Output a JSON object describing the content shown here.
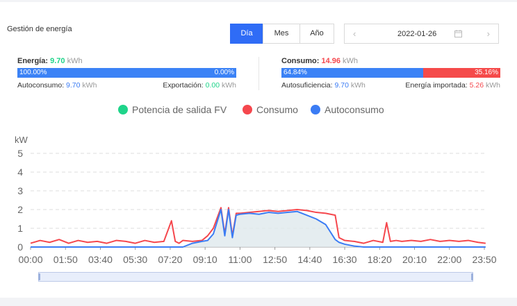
{
  "header": {
    "title": "Gestión de energía",
    "tabs": [
      {
        "label": "Día",
        "active": true
      },
      {
        "label": "Mes",
        "active": false
      },
      {
        "label": "Año",
        "active": false
      }
    ],
    "date": "2022-01-26",
    "prev_icon": "chevron-left-icon",
    "next_icon": "chevron-right-icon",
    "calendar_icon": "calendar-icon"
  },
  "energy": {
    "label": "Energía:",
    "value": "9.70",
    "unit": "kWh",
    "bar_left_pct": "100.00%",
    "bar_right_pct": "0.00%",
    "bar_left_fraction": 1.0,
    "self_consumption_label": "Autoconsumo:",
    "self_consumption_value": "9.70",
    "export_label": "Exportación:",
    "export_value": "0.00"
  },
  "consumption": {
    "label": "Consumo:",
    "value": "14.96",
    "unit": "kWh",
    "bar_left_pct": "64.84%",
    "bar_right_pct": "35.16%",
    "bar_left_fraction": 0.6484,
    "self_sufficiency_label": "Autosuficiencia:",
    "self_sufficiency_value": "9.70",
    "imported_label": "Energía importada:",
    "imported_value": "5.26"
  },
  "colors": {
    "accent": "#2f6cf6",
    "pv": "#1fd48a",
    "consumption": "#f5474d",
    "self_consumption": "#3b7cf4",
    "bar_blue": "#3b82f6",
    "bar_red": "#f54a4a"
  },
  "chart_data": {
    "type": "line",
    "ylabel": "kW",
    "ylim": [
      0,
      5
    ],
    "yticks": [
      "0",
      "1",
      "2",
      "3",
      "4",
      "5"
    ],
    "xticks": [
      "00:00",
      "01:50",
      "03:40",
      "05:30",
      "07:20",
      "09:10",
      "11:00",
      "12:50",
      "14:40",
      "16:30",
      "18:20",
      "20:10",
      "22:00",
      "23:50"
    ],
    "legend": [
      {
        "name": "Potencia de salida FV",
        "color": "#1fd48a"
      },
      {
        "name": "Consumo",
        "color": "#f5474d"
      },
      {
        "name": "Autoconsumo",
        "color": "#3b7cf4"
      }
    ],
    "x_hours": [
      0,
      0.5,
      1,
      1.5,
      2,
      2.5,
      3,
      3.5,
      4,
      4.5,
      5,
      5.5,
      6,
      6.5,
      7,
      7.4,
      7.6,
      7.8,
      8,
      8.5,
      9,
      9.3,
      9.6,
      10,
      10.2,
      10.4,
      10.6,
      10.8,
      11,
      11.5,
      12,
      12.5,
      13,
      13.5,
      14,
      14.5,
      15,
      15.5,
      16,
      16.2,
      16.5,
      17,
      17.5,
      18,
      18.5,
      18.7,
      18.9,
      19.2,
      19.5,
      20,
      20.5,
      21,
      21.5,
      22,
      22.5,
      23,
      23.5,
      23.9
    ],
    "series": [
      {
        "name": "Consumo",
        "values": [
          0.2,
          0.35,
          0.25,
          0.4,
          0.2,
          0.35,
          0.25,
          0.3,
          0.2,
          0.35,
          0.3,
          0.2,
          0.35,
          0.25,
          0.3,
          1.4,
          0.3,
          0.2,
          0.35,
          0.3,
          0.35,
          0.6,
          1.0,
          2.1,
          0.7,
          2.1,
          0.6,
          1.8,
          1.8,
          1.85,
          1.9,
          1.95,
          1.9,
          1.95,
          2.0,
          1.95,
          1.85,
          1.8,
          1.7,
          0.5,
          0.35,
          0.3,
          0.2,
          0.35,
          0.25,
          1.3,
          0.3,
          0.35,
          0.3,
          0.35,
          0.3,
          0.4,
          0.3,
          0.35,
          0.3,
          0.35,
          0.25,
          0.2
        ]
      },
      {
        "name": "Autoconsumo",
        "values": [
          0,
          0,
          0,
          0,
          0,
          0,
          0,
          0,
          0,
          0,
          0,
          0,
          0,
          0,
          0,
          0,
          0,
          0,
          0,
          0.2,
          0.3,
          0.35,
          0.7,
          2.0,
          0.6,
          2.0,
          0.5,
          1.7,
          1.75,
          1.8,
          1.75,
          1.85,
          1.8,
          1.85,
          1.9,
          1.7,
          1.5,
          1.2,
          0.4,
          0.25,
          0.15,
          0.05,
          0,
          0,
          0,
          0,
          0,
          0,
          0,
          0,
          0,
          0,
          0,
          0,
          0,
          0,
          0,
          0
        ]
      }
    ]
  }
}
